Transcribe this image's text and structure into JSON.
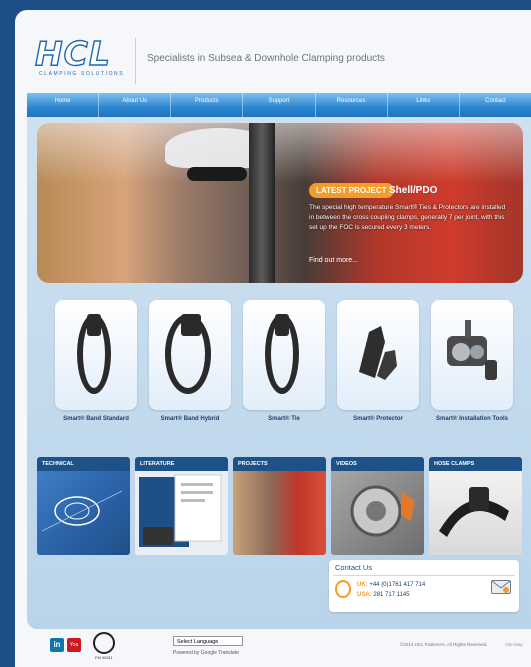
{
  "header": {
    "logo": "HCL",
    "logo_sub": "CLAMPING SOLUTIONS",
    "tagline": "Specialists in Subsea & Downhole Clamping products"
  },
  "nav": {
    "items": [
      "Home",
      "About Us",
      "Products",
      "Support",
      "Resources",
      "Links",
      "Contact"
    ]
  },
  "hero": {
    "tag": "LATEST PROJECT",
    "title": "Shell/PDO",
    "description": "The special high temperature Smart® Ties & Protectors are installed in between the cross coupling clamps, generally 7 per joint, with this set up the FOC is secured every 3 meters.",
    "more": "Find out more..."
  },
  "products": [
    {
      "name": "Smart® Band Standard"
    },
    {
      "name": "Smart® Band Hybrid"
    },
    {
      "name": "Smart® Tie"
    },
    {
      "name": "Smart® Protector"
    },
    {
      "name": "Smart® Installation Tools"
    }
  ],
  "categories": [
    {
      "label": "TECHNICAL"
    },
    {
      "label": "LITERATURE"
    },
    {
      "label": "PROJECTS"
    },
    {
      "label": "VIDEOS"
    },
    {
      "label": "HOSE CLAMPS"
    }
  ],
  "contact": {
    "title": "Contact Us",
    "uk_label": "UK:",
    "uk_phone": "+44 (0)1761 417 714",
    "usa_label": "USA:",
    "usa_phone": "281 717 1145"
  },
  "footer": {
    "linkedin": "in",
    "youtube": "You",
    "cert": "FM 00911",
    "language": "Select Language",
    "powered": "Powered by Google Translate",
    "copyright": "©2014 HCL Fasteners. All Rights Reserved.",
    "sitemap": "Site Map"
  },
  "colors": {
    "brand": "#1f6ab1",
    "accent": "#f39c2a",
    "nav": "#2c86cf",
    "outer": "#1d4f86"
  }
}
